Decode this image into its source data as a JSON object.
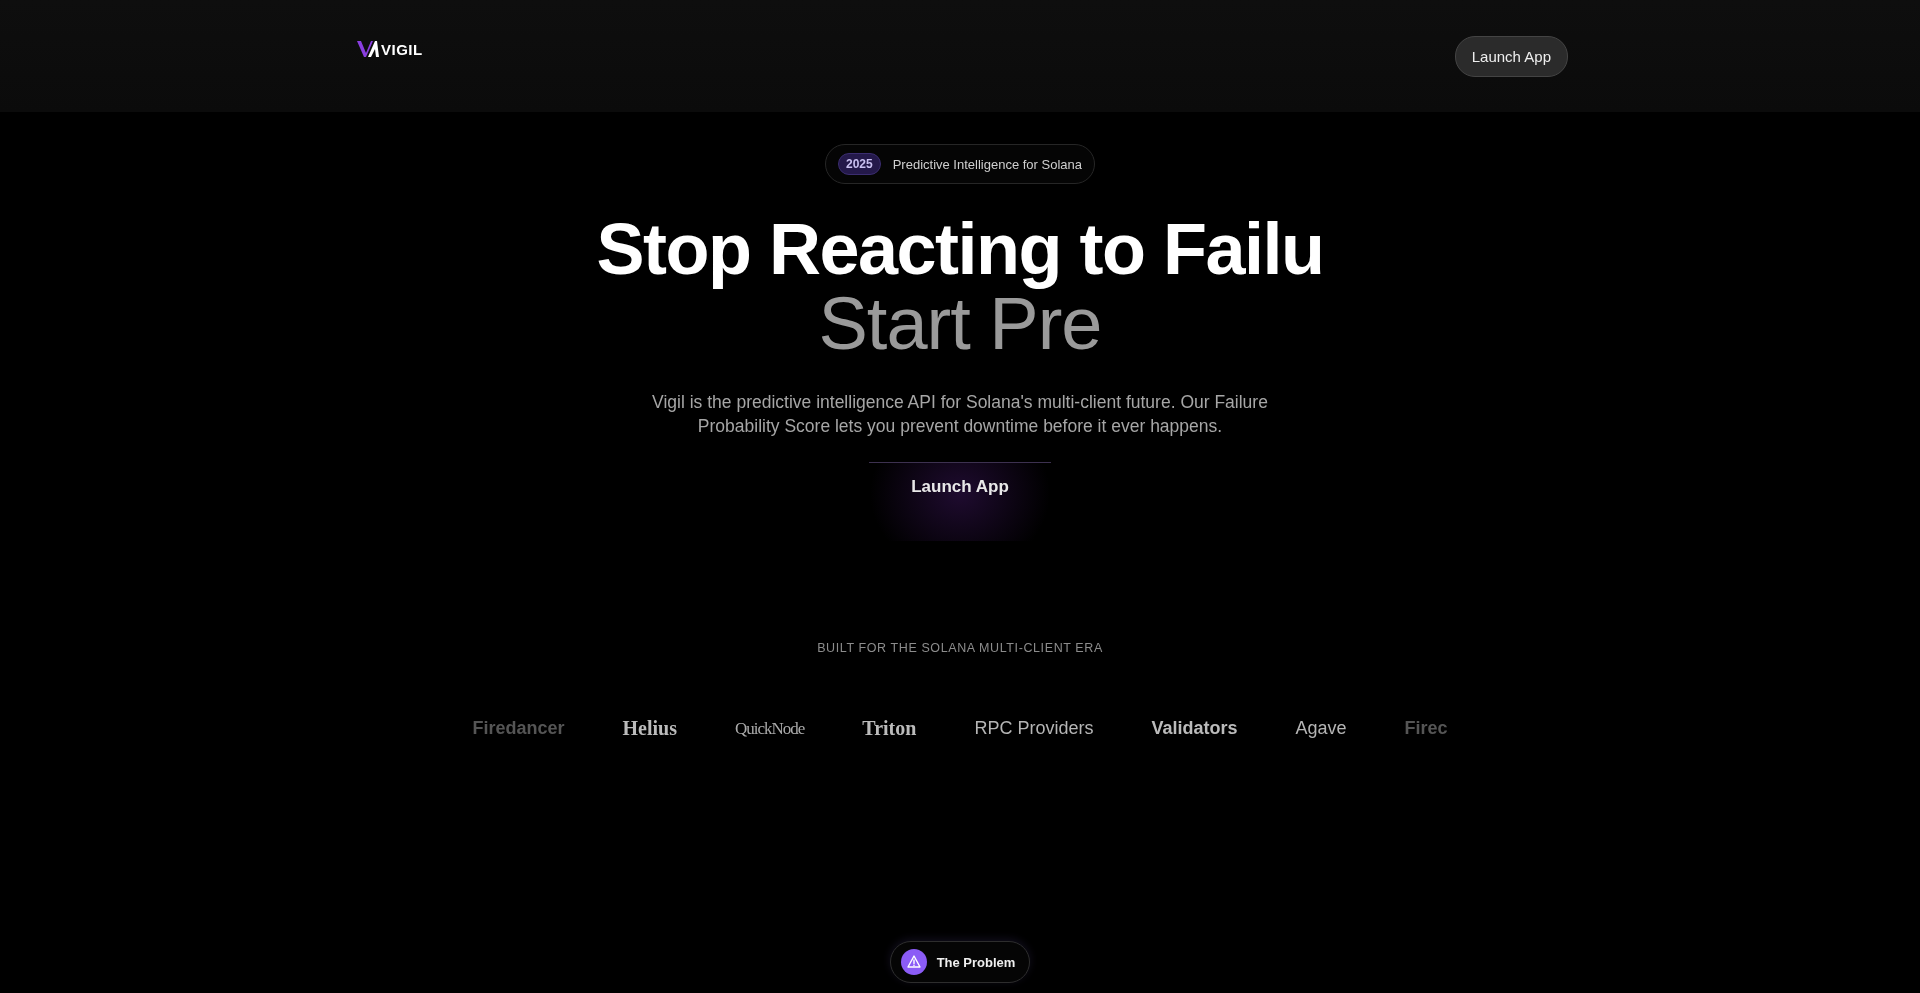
{
  "header": {
    "logo": "VIGIL",
    "button": "Launch App"
  },
  "hero": {
    "badge": {
      "year": "2025",
      "text": "Predictive Intelligence for Solana"
    },
    "title_line_1": "Stop Reacting to Failu",
    "title_line_2": "Start Pre",
    "description": "Vigil is the predictive intelligence API for Solana's multi-client future. Our Failure Probability Score lets you prevent downtime before it ever happens.",
    "button": "Launch App"
  },
  "partners": {
    "heading": "BUILT FOR THE SOLANA MULTI-CLIENT ERA",
    "logos": [
      {
        "name": "Firedancer",
        "kind": "sans-bold"
      },
      {
        "name": "Helius",
        "kind": "serif-bold"
      },
      {
        "name": "QuickNode",
        "kind": "serif-condensed"
      },
      {
        "name": "Triton",
        "kind": "serif-bold"
      },
      {
        "name": "RPC Providers",
        "kind": "sans"
      },
      {
        "name": "Validators",
        "kind": "sans-bold"
      },
      {
        "name": "Agave",
        "kind": "sans"
      },
      {
        "name": "Firec",
        "kind": "sans-bold"
      }
    ]
  },
  "section_pill": {
    "label": "The Problem"
  }
}
